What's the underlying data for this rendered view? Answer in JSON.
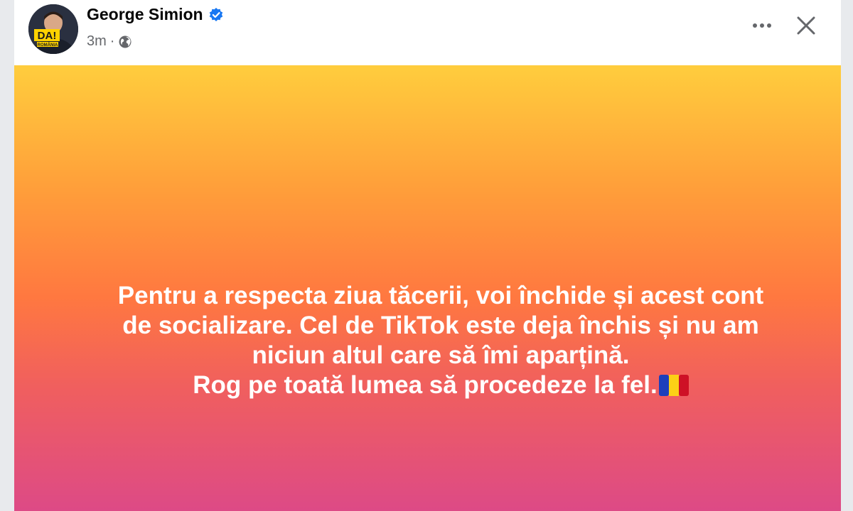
{
  "post": {
    "author": "George Simion",
    "time": "3m",
    "separator": "·",
    "privacy_icon": "globe-icon",
    "verified_icon": "verified-badge-icon",
    "avatar_text": "DA!",
    "avatar_subtext": "ROMÂNIA",
    "text_lines": [
      "Pentru a respecta ziua tăcerii, voi închide și acest cont",
      "de socializare. Cel de TikTok este deja închis și nu am",
      "niciun altul care să îmi aparțină.",
      "Rog pe toată lumea să procedeze la fel."
    ],
    "emoji": "romania-flag-icon"
  },
  "actions": {
    "more_icon": "more-options-icon",
    "close_icon": "close-icon"
  },
  "colors": {
    "gradient_top": "#ffcd3d",
    "gradient_mid": "#ff7840",
    "gradient_bottom": "#dd4a86",
    "verified_blue": "#1877f2",
    "text_gray": "#65676b"
  }
}
